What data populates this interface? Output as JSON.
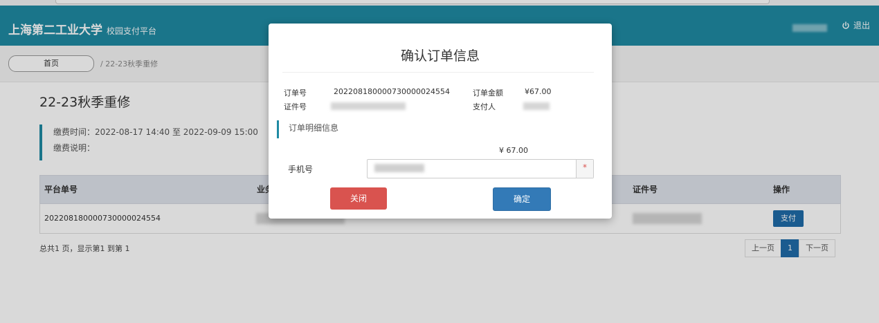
{
  "header": {
    "brand": "上海第二工业大学",
    "brand_sub": "校园支付平台",
    "logout_label": "退出"
  },
  "breadcrumb": {
    "home": "首页",
    "current": "/ 22-23秋季重修"
  },
  "page": {
    "title": "22-23秋季重修",
    "pay_time": "缴费时间：2022-08-17 14:40 至 2022-09-09 15:00",
    "pay_note": "缴费说明："
  },
  "table": {
    "columns": [
      "平台单号",
      "业务",
      "证件号",
      "操作"
    ],
    "rows": [
      {
        "order_no": "20220818000073000002455​4",
        "action": "支付"
      }
    ]
  },
  "footer": {
    "summary": "总共1 页，显示第1 到第 1",
    "pager": {
      "prev": "上一页",
      "current": "1",
      "next": "下一页"
    }
  },
  "modal": {
    "title": "确认订单信息",
    "order_no_label": "订单号",
    "order_no": "20220818000073000002455​4",
    "amount_label": "订单金额",
    "amount": "¥67.00",
    "id_label": "证件号",
    "payer_label": "支付人",
    "section": "订单明细信息",
    "total": "¥ 67.00",
    "phone_label": "手机号",
    "required_mark": "*",
    "close_label": "关闭",
    "confirm_label": "确定"
  },
  "colors": {
    "header": "#1f8aa3",
    "primary": "#337ab7",
    "danger": "#d9534f"
  }
}
